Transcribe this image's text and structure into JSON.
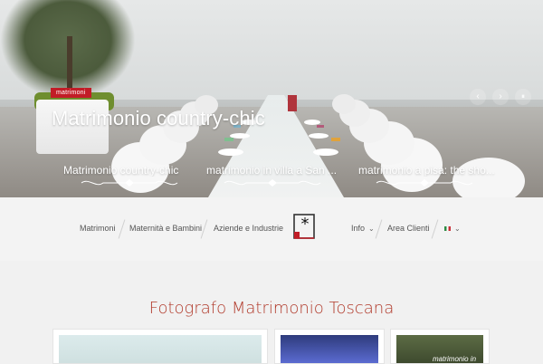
{
  "hero": {
    "tag": "matrimoni",
    "title": "Matrimonio country-chic",
    "controls": {
      "prev": "‹",
      "next": "›",
      "pause": "⏸"
    },
    "thumbs": [
      {
        "label": "Matrimonio country-chic"
      },
      {
        "label": "matrimonio in villa a San ..."
      },
      {
        "label": "matrimonio a pisa: the sho..."
      }
    ]
  },
  "nav": {
    "items": [
      {
        "label": "Matrimoni"
      },
      {
        "label": "Maternità e Bambini"
      },
      {
        "label": "Aziende e Industrie"
      },
      {
        "label": "Info"
      },
      {
        "label": "Area Clienti"
      }
    ],
    "info_chevron": "⌄",
    "lang_chevron": "⌄",
    "logo_symbol": "*"
  },
  "content": {
    "title": "Fotografo Matrimonio Toscana",
    "card3_overlay": "matrimonio in"
  },
  "colors": {
    "accent_red": "#c21d27",
    "title_red": "#b13a2b"
  }
}
